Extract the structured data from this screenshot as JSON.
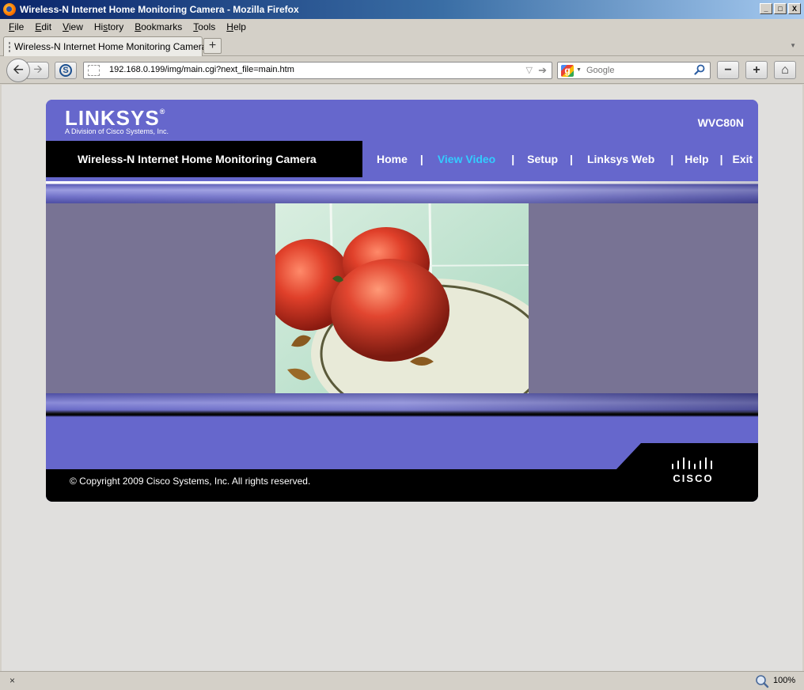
{
  "window": {
    "title": "Wireless-N Internet Home Monitoring Camera - Mozilla Firefox",
    "buttons": {
      "minimize": "_",
      "maximize": "□",
      "close": "X"
    }
  },
  "menubar": {
    "items": [
      {
        "key": "F",
        "rest": "ile"
      },
      {
        "key": "E",
        "rest": "dit"
      },
      {
        "key": "V",
        "rest": "iew"
      },
      {
        "pre": "Hi",
        "key": "s",
        "rest": "tory"
      },
      {
        "key": "B",
        "rest": "ookmarks"
      },
      {
        "key": "T",
        "rest": "ools"
      },
      {
        "key": "H",
        "rest": "elp"
      }
    ]
  },
  "tabs": [
    {
      "title": "Wireless-N Internet Home Monitoring Camera",
      "active": true
    }
  ],
  "tabbar": {
    "new_tab": "+"
  },
  "navbar": {
    "back": "🡨",
    "forward": "🡪",
    "s_label": "S",
    "url": "192.168.0.199/img/main.cgi?next_file=main.htm",
    "search_placeholder": "Google",
    "zoom_out": "−",
    "zoom_in": "+",
    "home": "⌂"
  },
  "page": {
    "logo": "LINKSYS",
    "logo_reg": "®",
    "logo_sub": "A Division of Cisco Systems, Inc.",
    "model": "WVC80N",
    "nav_title": "Wireless-N Internet Home Monitoring Camera",
    "nav_links": [
      {
        "label": "Home",
        "active": false
      },
      {
        "label": "View Video",
        "active": true
      },
      {
        "label": "Setup",
        "active": false
      },
      {
        "label": "Linksys Web",
        "active": false
      },
      {
        "label": "Help",
        "active": false
      },
      {
        "label": "Exit",
        "active": false
      }
    ],
    "nav_separator": "|",
    "copyright": "© Copyright 2009 Cisco Systems, Inc. All rights reserved.",
    "cisco_logo": "CISCO",
    "colors": {
      "brand": "#6667cc",
      "active_link": "#33ccff",
      "video_area": "#787394",
      "header_black": "#000000"
    }
  },
  "statusbar": {
    "close": "×",
    "zoom": "100%"
  }
}
